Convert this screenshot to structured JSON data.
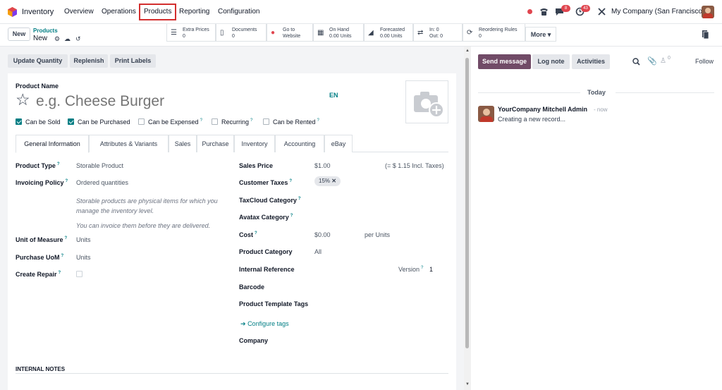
{
  "topbar": {
    "app_name": "Inventory",
    "menu": [
      "Overview",
      "Operations",
      "Products",
      "Reporting",
      "Configuration"
    ],
    "active_menu": "Products",
    "chat_badge": "8",
    "activity_badge": "43",
    "company": "My Company (San Francisco)"
  },
  "control": {
    "new_label": "New",
    "breadcrumb_parent": "Products",
    "breadcrumb_current": "New",
    "smart_buttons": [
      {
        "icon": "list-icon",
        "l1": "Extra Prices",
        "l2": "0"
      },
      {
        "icon": "document-icon",
        "l1": "Documents",
        "l2": "0"
      },
      {
        "icon": "globe-icon",
        "l1": "Go to",
        "l2": "Website"
      },
      {
        "icon": "cubes-icon",
        "l1": "On Hand",
        "l2": "0.00 Units"
      },
      {
        "icon": "area-chart-icon",
        "l1": "Forecasted",
        "l2": "0.00 Units"
      },
      {
        "icon": "exchange-icon",
        "l1": "In: 0",
        "l2": "Out: 0"
      },
      {
        "icon": "refresh-icon",
        "l1": "Reordering Rules",
        "l2": "0"
      }
    ],
    "more_label": "More"
  },
  "actions": [
    "Update Quantity",
    "Replenish",
    "Print Labels"
  ],
  "form": {
    "product_name_label": "Product Name",
    "name_placeholder": "e.g. Cheese Burger",
    "lang": "EN",
    "checkboxes": [
      {
        "label": "Can be Sold",
        "checked": true
      },
      {
        "label": "Can be Purchased",
        "checked": true
      },
      {
        "label": "Can be Expensed",
        "checked": false,
        "help": true
      },
      {
        "label": "Recurring",
        "checked": false,
        "help": true
      },
      {
        "label": "Can be Rented",
        "checked": false,
        "help": true
      }
    ],
    "tabs": [
      "General Information",
      "Attributes & Variants",
      "Sales",
      "Purchase",
      "Inventory",
      "Accounting",
      "eBay"
    ],
    "active_tab": "General Information",
    "left": {
      "product_type_label": "Product Type",
      "product_type_value": "Storable Product",
      "invoicing_policy_label": "Invoicing Policy",
      "invoicing_policy_value": "Ordered quantities",
      "note1": "Storable products are physical items for which you manage the inventory level.",
      "note2": "You can invoice them before they are delivered.",
      "uom_label": "Unit of Measure",
      "uom_value": "Units",
      "purchase_uom_label": "Purchase UoM",
      "purchase_uom_value": "Units",
      "create_repair_label": "Create Repair"
    },
    "right": {
      "sales_price_label": "Sales Price",
      "sales_price_value": "$1.00",
      "incl_taxes": "(= $ 1.15 Incl. Taxes)",
      "customer_taxes_label": "Customer Taxes",
      "tax_tag": "15%",
      "taxcloud_label": "TaxCloud Category",
      "avatax_label": "Avatax Category",
      "cost_label": "Cost",
      "cost_value": "$0.00",
      "per_units": "per Units",
      "category_label": "Product Category",
      "category_value": "All",
      "internal_ref_label": "Internal Reference",
      "version_label": "Version",
      "version_value": "1",
      "barcode_label": "Barcode",
      "tags_label": "Product Template Tags",
      "configure_tags": "Configure tags",
      "company_label": "Company"
    },
    "internal_notes": "INTERNAL NOTES"
  },
  "chatter": {
    "send_message": "Send message",
    "log_note": "Log note",
    "activities": "Activities",
    "follower_count": "0",
    "follow": "Follow",
    "day": "Today",
    "author": "YourCompany Mitchell Admin",
    "time": "- now",
    "body": "Creating a new record..."
  }
}
